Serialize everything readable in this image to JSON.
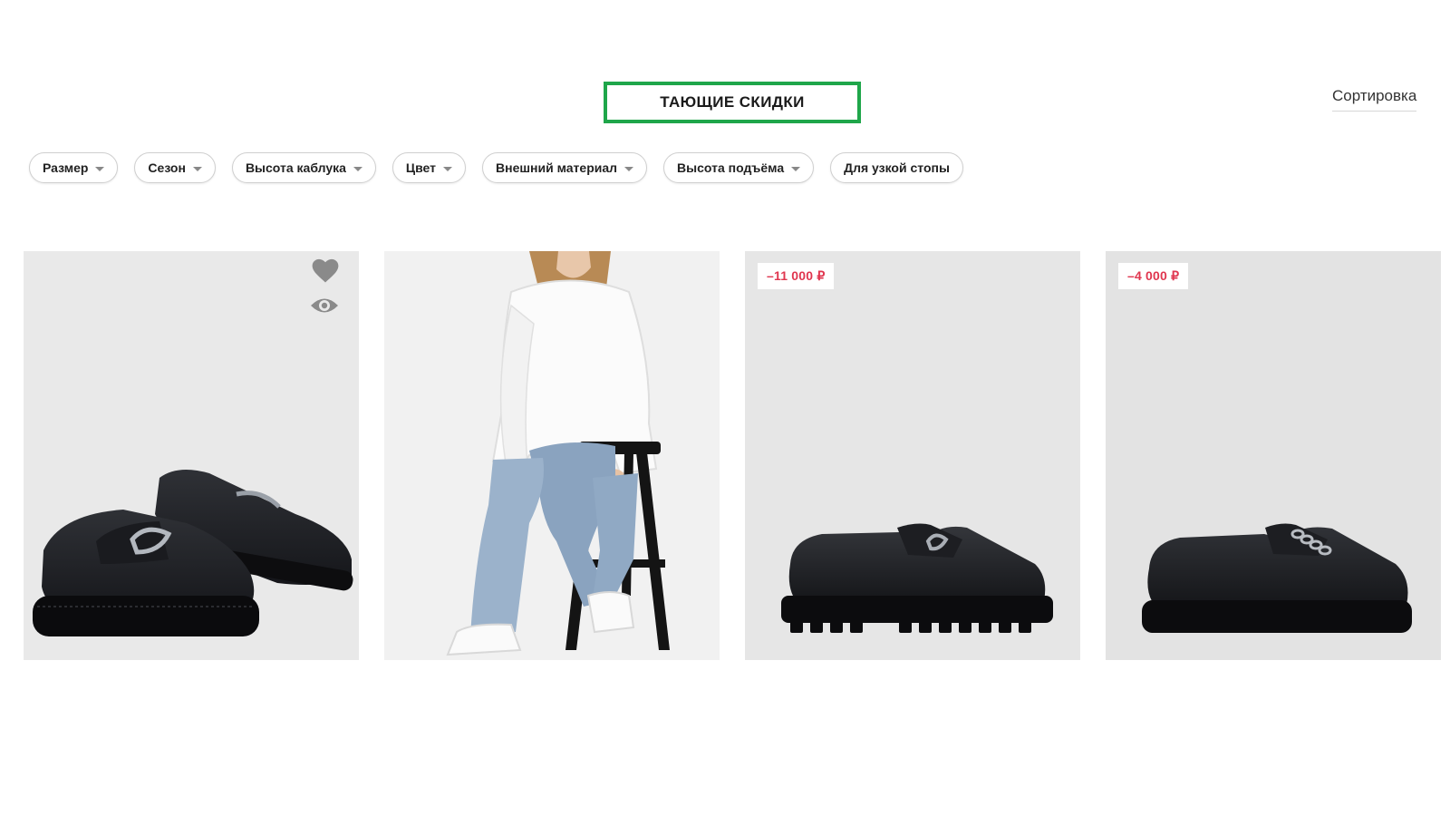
{
  "header": {
    "title": "ТАЮЩИЕ СКИДКИ",
    "sort_label": "Сортировка",
    "title_border_color": "#1fa64a"
  },
  "filters": [
    {
      "label": "Размер",
      "dropdown": true
    },
    {
      "label": "Сезон",
      "dropdown": true
    },
    {
      "label": "Высота каблука",
      "dropdown": true
    },
    {
      "label": "Цвет",
      "dropdown": true
    },
    {
      "label": "Внешний материал",
      "dropdown": true
    },
    {
      "label": "Высота подъёма",
      "dropdown": true
    },
    {
      "label": "Для узкой стопы",
      "dropdown": false
    }
  ],
  "products": [
    {
      "image": "black-loafers-pair-image",
      "badge": "",
      "icons": [
        "heart-icon",
        "eye-icon"
      ]
    },
    {
      "image": "model-wearing-white-sneakers-image",
      "badge": ""
    },
    {
      "image": "black-loafer-side-view-image",
      "badge": "–11 000 ₽"
    },
    {
      "image": "black-loafer-chain-side-view-image",
      "badge": "–4 000 ₽"
    }
  ],
  "colors": {
    "discount_text": "#e0364f",
    "icon_gray": "#8a8a8a"
  }
}
